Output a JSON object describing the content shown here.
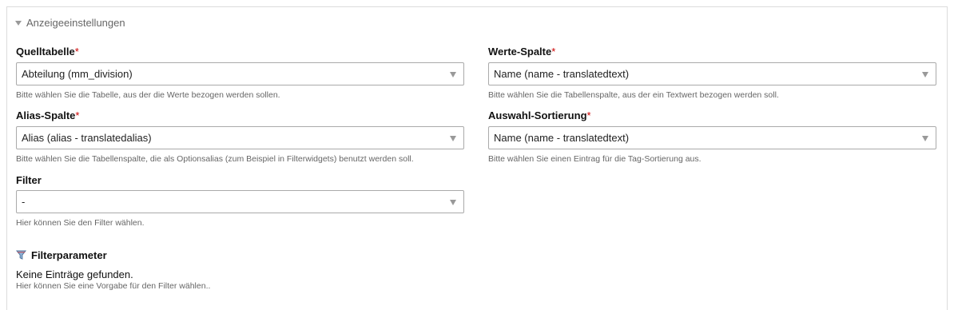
{
  "section": {
    "legend": "Anzeigeeinstellungen"
  },
  "fields": {
    "quelltabelle": {
      "label": "Quelltabelle",
      "required": "*",
      "value": "Abteilung (mm_division)",
      "help": "Bitte wählen Sie die Tabelle, aus der die Werte bezogen werden sollen."
    },
    "werte_spalte": {
      "label": "Werte-Spalte",
      "required": "*",
      "value": "Name (name - translatedtext)",
      "help": "Bitte wählen Sie die Tabellenspalte, aus der ein Textwert bezogen werden soll."
    },
    "alias_spalte": {
      "label": "Alias-Spalte",
      "required": "*",
      "value": "Alias (alias - translatedalias)",
      "help": "Bitte wählen Sie die Tabellenspalte, die als Optionsalias (zum Beispiel in Filterwidgets) benutzt werden soll."
    },
    "auswahl_sortierung": {
      "label": "Auswahl-Sortierung",
      "required": "*",
      "value": "Name (name - translatedtext)",
      "help": "Bitte wählen Sie einen Eintrag für die Tag-Sortierung aus."
    },
    "filter": {
      "label": "Filter",
      "value": "-",
      "help": "Hier können Sie den Filter wählen."
    }
  },
  "filterparameter": {
    "title": "Filterparameter",
    "empty": "Keine Einträge gefunden.",
    "help": "Hier können Sie eine Vorgabe für den Filter wählen.."
  },
  "icons": {
    "legend": "collapse-triangle-icon",
    "select_arrow": "chevron-down-icon",
    "filterparameter": "funnel-icon"
  }
}
